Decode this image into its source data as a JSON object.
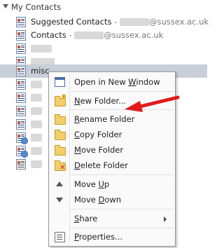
{
  "tree": {
    "title": "My Contacts",
    "items": [
      {
        "name": "Suggested Contacts",
        "sep": " - ",
        "domain": "@sussex.ac.uk"
      },
      {
        "name": "Contacts",
        "sep": " - ",
        "domain": "@sussex.ac.uk"
      },
      {
        "name": ""
      },
      {
        "name": ""
      },
      {
        "name": "misc"
      }
    ]
  },
  "context_menu": {
    "open_new_window": {
      "pre": "Open in New ",
      "key": "W",
      "post": "indow"
    },
    "new_folder": {
      "pre": "",
      "key": "N",
      "post": "ew Folder..."
    },
    "rename_folder": {
      "pre": "",
      "key": "R",
      "post": "ename Folder"
    },
    "copy_folder": {
      "pre": "",
      "key": "C",
      "post": "opy Folder"
    },
    "move_folder": {
      "pre": "",
      "key": "M",
      "post": "ove Folder"
    },
    "delete_folder": {
      "pre": "",
      "key": "D",
      "post": "elete Folder"
    },
    "move_up": {
      "pre": "Move ",
      "key": "U",
      "post": "p"
    },
    "move_down": {
      "pre": "Move ",
      "key": "D",
      "post": "own"
    },
    "share": {
      "pre": "",
      "key": "S",
      "post": "hare"
    },
    "properties": {
      "pre": "",
      "key": "P",
      "post": "roperties..."
    }
  },
  "colors": {
    "selection": "#c9cfd8",
    "annotation_arrow": "#e11b1b"
  }
}
